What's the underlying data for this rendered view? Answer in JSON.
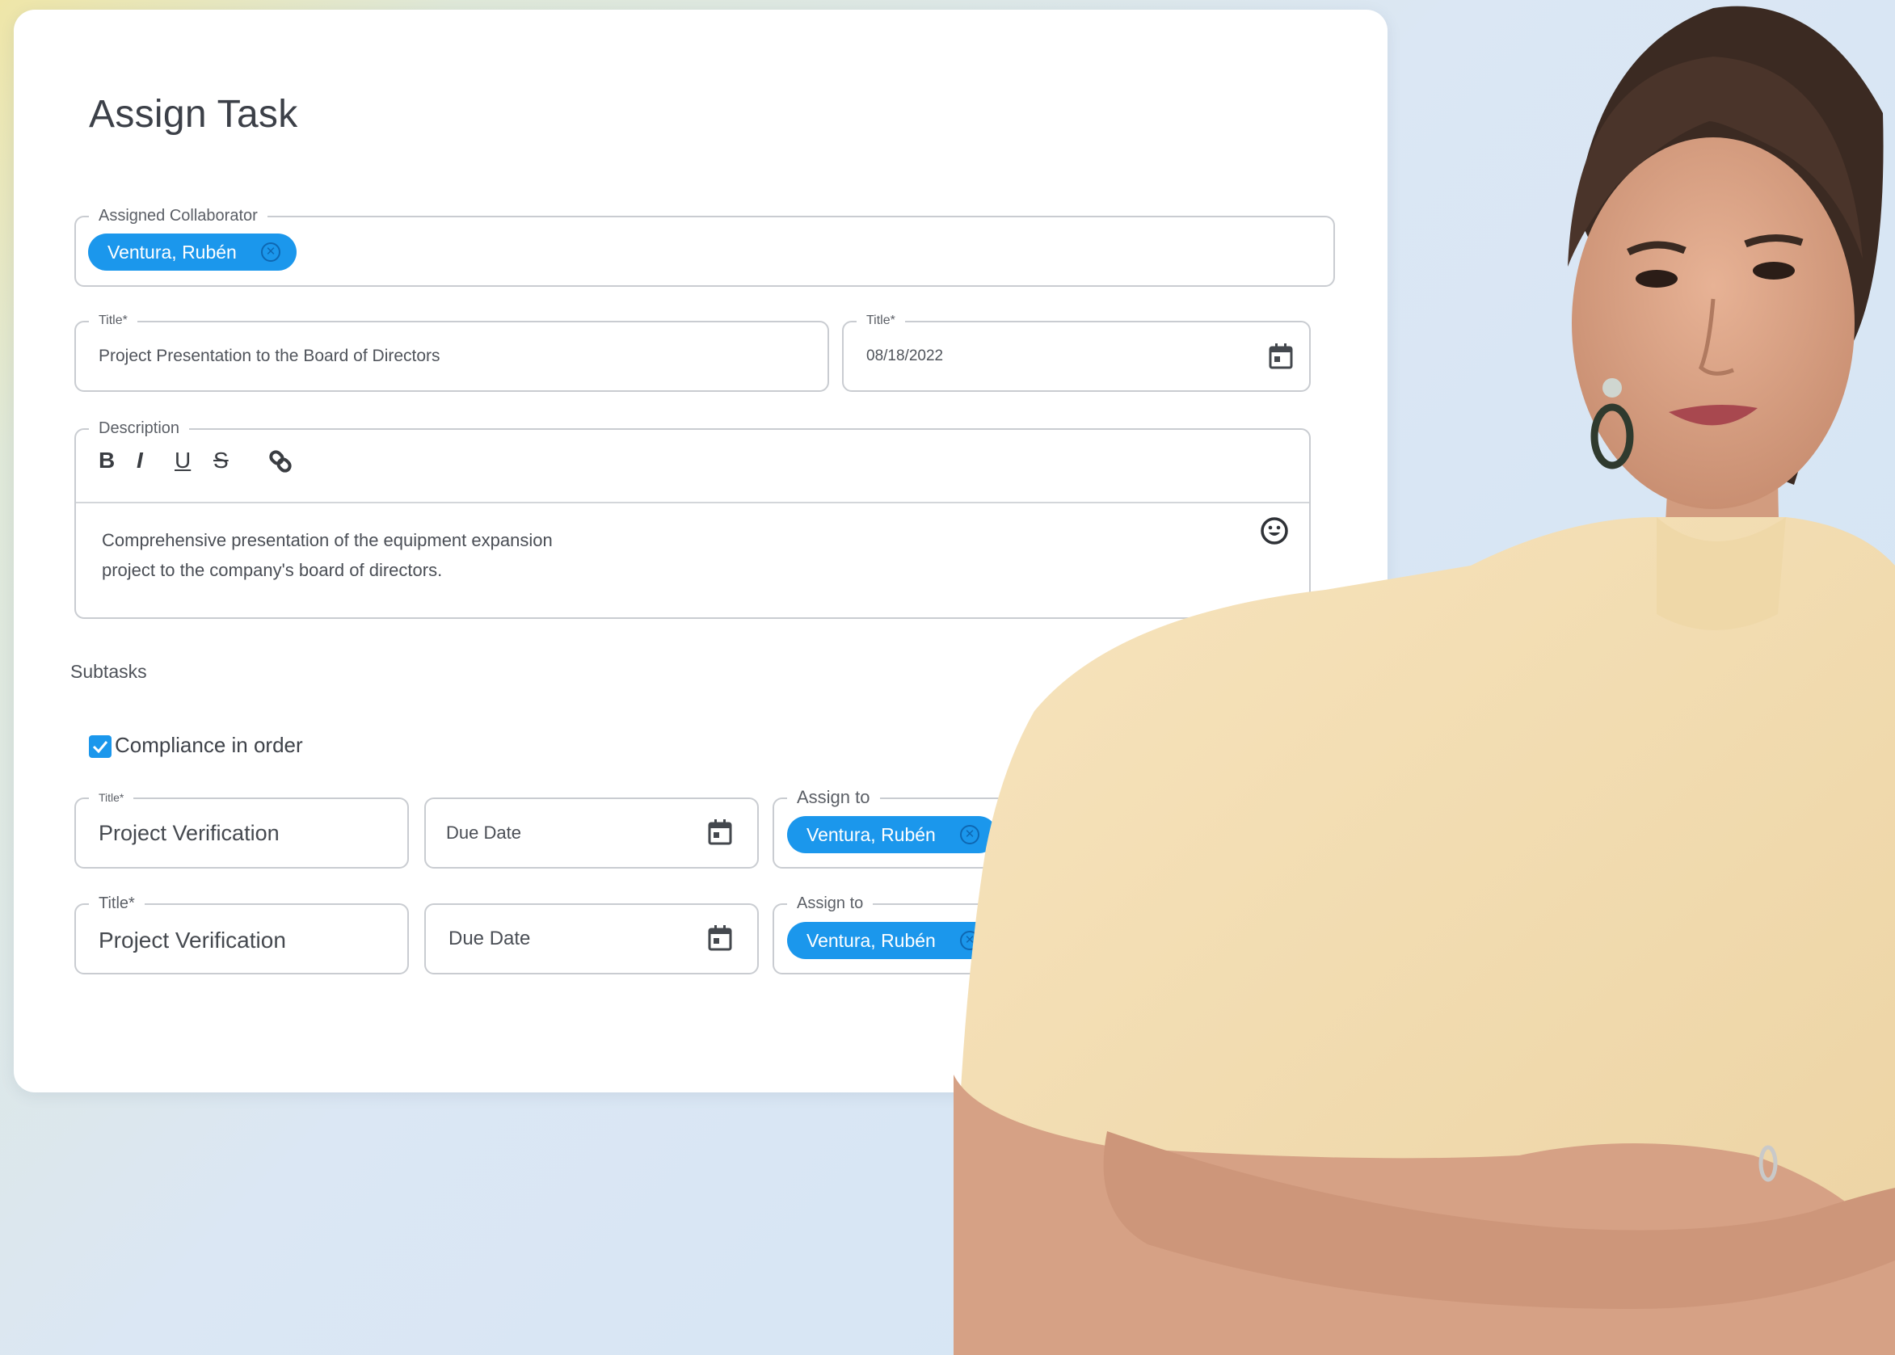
{
  "form": {
    "title": "Assign Task",
    "collaborator": {
      "label": "Assigned Collaborator",
      "chip": "Ventura, Rubén"
    },
    "title_field": {
      "label": "Title*",
      "value": "Project Presentation to the Board of Directors"
    },
    "date_field": {
      "label": "Title*",
      "value": "08/18/2022"
    },
    "description": {
      "label": "Description",
      "toolbar": {
        "bold": "B",
        "italic": "I",
        "underline": "U",
        "strike": "S"
      },
      "line1": "Comprehensive presentation of the equipment expansion",
      "line2": "project to the company's board of directors."
    },
    "subtasks": {
      "label": "Subtasks",
      "checkbox_label": "Compliance in order",
      "rows": [
        {
          "title_label": "Title*",
          "title_value": "Project Verification",
          "due_placeholder": "Due Date",
          "assign_label": "Assign to",
          "chip": "Ventura, Rubén"
        },
        {
          "title_label": "Title*",
          "title_value": "Project Verification",
          "due_placeholder": "Due Date",
          "assign_label": "Assign to",
          "chip": "Ventura, Rubén"
        }
      ]
    }
  },
  "colors": {
    "accent": "#1b97ec",
    "border": "#c9ccd1",
    "shirt": "#f4dfb3"
  },
  "icons": [
    "calendar-icon",
    "link-icon",
    "emoji-icon",
    "check-icon",
    "chip-remove-icon"
  ]
}
